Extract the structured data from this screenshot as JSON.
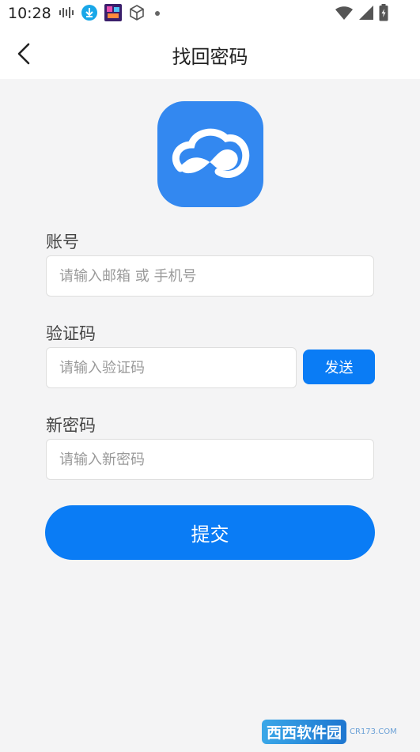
{
  "status_bar": {
    "time": "10:28",
    "icons": [
      "audio-wave-icon",
      "download-icon",
      "app-thumbnail-icon",
      "cube-icon",
      "dot-icon",
      "wifi-icon",
      "signal-icon",
      "battery-icon"
    ]
  },
  "nav": {
    "title": "找回密码",
    "back_icon": "chevron-left-icon"
  },
  "logo": {
    "icon": "cloud-logo-icon",
    "color": "#3388f0"
  },
  "form": {
    "account": {
      "label": "账号",
      "placeholder": "请输入邮箱 或 手机号",
      "value": ""
    },
    "code": {
      "label": "验证码",
      "placeholder": "请输入验证码",
      "value": "",
      "send_label": "发送"
    },
    "new_password": {
      "label": "新密码",
      "placeholder": "请输入新密码",
      "value": ""
    },
    "submit_label": "提交"
  },
  "watermark": {
    "text": "西西软件园",
    "subtext": "CR173.COM"
  },
  "colors": {
    "accent": "#0a7cf5",
    "background": "#f4f4f5"
  }
}
